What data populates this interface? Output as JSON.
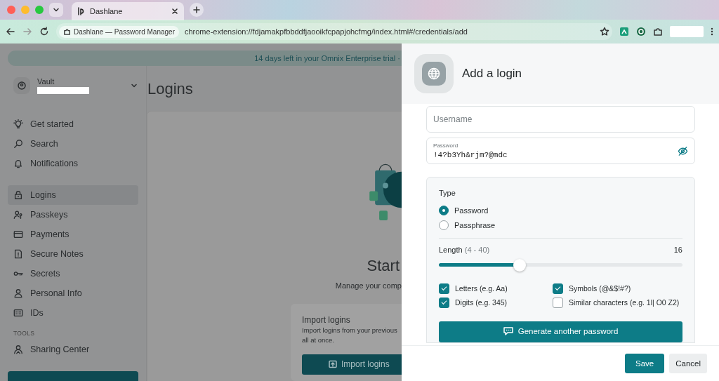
{
  "browser": {
    "tab_title": "Dashlane",
    "site_chip": "Dashlane — Password Manager",
    "url": "chrome-extension://fdjamakpfbbddfjaooikfcpapjohcfmg/index.html#/credentials/add"
  },
  "banner": "14 days left in your Omnix Enterprise trial ·",
  "sidebar": {
    "vault_label": "Vault",
    "groups": [
      {
        "items": [
          {
            "label": "Get started",
            "selected": false
          },
          {
            "label": "Search",
            "selected": false
          },
          {
            "label": "Notifications",
            "selected": false
          }
        ]
      },
      {
        "items": [
          {
            "label": "Logins",
            "selected": true
          },
          {
            "label": "Passkeys",
            "selected": false
          },
          {
            "label": "Payments",
            "selected": false
          },
          {
            "label": "Secure Notes",
            "selected": false
          },
          {
            "label": "Secrets",
            "selected": false
          },
          {
            "label": "Personal Info",
            "selected": false
          },
          {
            "label": "IDs",
            "selected": false
          }
        ]
      },
      {
        "heading": "TOOLS",
        "items": [
          {
            "label": "Sharing Center",
            "selected": false
          }
        ]
      }
    ]
  },
  "main": {
    "title": "Logins",
    "empty_title": "Start",
    "empty_subtitle": "Manage your comp",
    "import": {
      "title": "Import logins",
      "lines": [
        "Import logins from your previous",
        "all at once."
      ],
      "button": "Import logins"
    }
  },
  "panel": {
    "title": "Add a login",
    "username": {
      "placeholder": "Username"
    },
    "password": {
      "label": "Password",
      "value": "!4?b3Yh&rjm?@mdc"
    },
    "generator": {
      "type_label": "Type",
      "types": [
        {
          "label": "Password",
          "selected": true
        },
        {
          "label": "Passphrase",
          "selected": false
        }
      ],
      "length_label": "Length",
      "length_range": "(4 - 40)",
      "length_value": "16",
      "level": 0.33,
      "options": [
        {
          "label": "Letters (e.g. Aa)",
          "checked": true
        },
        {
          "label": "Symbols (@&$!#?)",
          "checked": true
        },
        {
          "label": "Digits (e.g. 345)",
          "checked": true
        },
        {
          "label": "Similar characters (e.g. 1l| O0 Z2)",
          "checked": false
        }
      ],
      "generate_button": "Generate another password"
    },
    "buttons": [
      {
        "label": "Save",
        "kind": "primary"
      },
      {
        "label": "Cancel",
        "kind": "secondary"
      }
    ]
  }
}
